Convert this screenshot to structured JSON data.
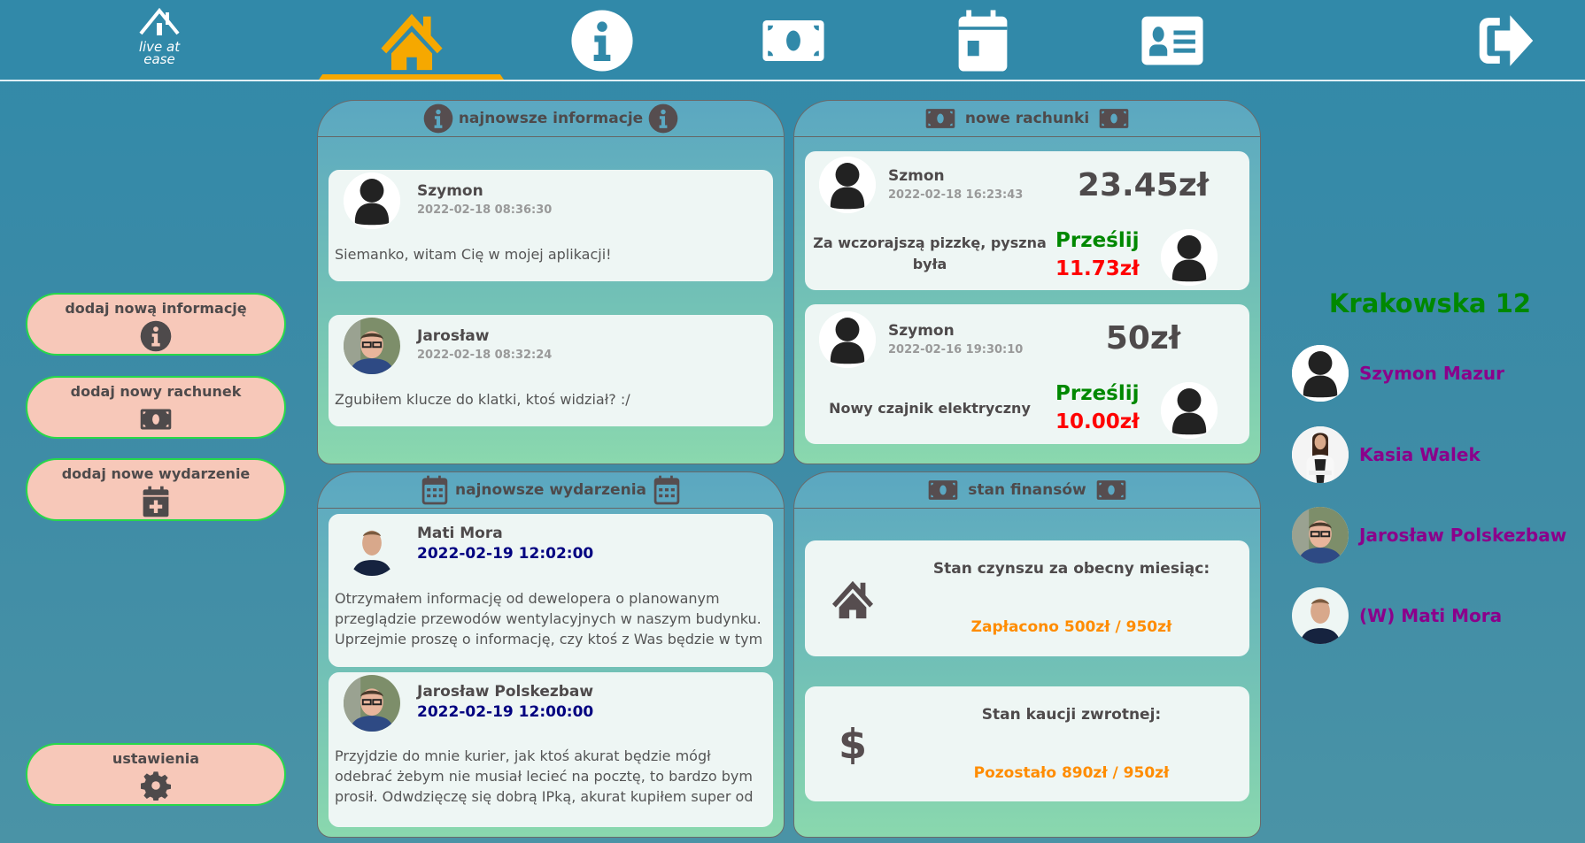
{
  "header": {
    "logo_text": [
      "live at",
      "ease"
    ],
    "nav": [
      {
        "icon": "home-icon",
        "active": true
      },
      {
        "icon": "info-icon"
      },
      {
        "icon": "money-bill-icon"
      },
      {
        "icon": "calendar-icon"
      },
      {
        "icon": "contact-card-icon"
      },
      {
        "icon": "logout-icon"
      }
    ],
    "active_color": "#f6a800"
  },
  "sidebar": {
    "buttons": [
      {
        "label": "dodaj nową informację",
        "icon": "info-icon"
      },
      {
        "label": "dodaj nowy rachunek",
        "icon": "money-bill-icon"
      },
      {
        "label": "dodaj nowe wydarzenie",
        "icon": "calendar-plus-icon"
      }
    ],
    "settings": {
      "label": "ustawienia",
      "icon": "gear-icon"
    }
  },
  "info_panel": {
    "title": "najnowsze informacje",
    "items": [
      {
        "author": "Szymon",
        "date": "2022-02-18 08:36:30",
        "text": "Siemanko, witam Cię w mojej aplikacji!",
        "avatar": "default"
      },
      {
        "author": "Jarosław",
        "date": "2022-02-18 08:32:24",
        "text": "Zgubiłem klucze do klatki, ktoś widział? :/",
        "avatar": "photo"
      }
    ]
  },
  "bills_panel": {
    "title": "nowe rachunki",
    "items": [
      {
        "author": "Szmon",
        "date": "2022-02-18 16:23:43",
        "amount": "23.45zł",
        "description": "Za wczorajszą pizzkę, pyszna była",
        "action": "Prześlij",
        "share": "11.73zł"
      },
      {
        "author": "Szymon",
        "date": "2022-02-16 19:30:10",
        "amount": "50zł",
        "description": "Nowy czajnik elektryczny",
        "action": "Prześlij",
        "share": "10.00zł"
      }
    ]
  },
  "events_panel": {
    "title": "najnowsze wydarzenia",
    "items": [
      {
        "author": "Mati Mora",
        "date": "2022-02-19 12:02:00",
        "text": "Otrzymałem informację od dewelopera o planowanym przeglądzie przewodów wentylacyjnych w naszym budynku. Uprzejmie proszę o informację, czy ktoś z Was będzie w tym"
      },
      {
        "author": "Jarosław Polskezbaw",
        "date": "2022-02-19 12:00:00",
        "text": "Przyjdzie do mnie kurier, jak ktoś akurat będzie mógł odebrać żebym nie musiał lecieć na pocztę, to bardzo bym prosił. Odwdzięczę się dobrą IPką, akurat kupiłem super od Trzech"
      }
    ]
  },
  "finance_panel": {
    "title": "stan finansów",
    "items": [
      {
        "label": "Stan czynszu za obecny miesiąc:",
        "value": "Zapłacono 500zł / 950zł",
        "icon": "home-icon"
      },
      {
        "label": "Stan kaucji zwrotnej:",
        "value": "Pozostało 890zł / 950zł",
        "icon": "dollar-icon"
      }
    ]
  },
  "flat": {
    "address": "Krakowska 12",
    "members": [
      {
        "name": "Szymon Mazur",
        "avatar": "default"
      },
      {
        "name": "Kasia Walek",
        "avatar": "photo"
      },
      {
        "name": "Jarosław Polskezbaw",
        "avatar": "photo"
      },
      {
        "name": "(W) Mati Mora",
        "avatar": "photo"
      }
    ]
  }
}
